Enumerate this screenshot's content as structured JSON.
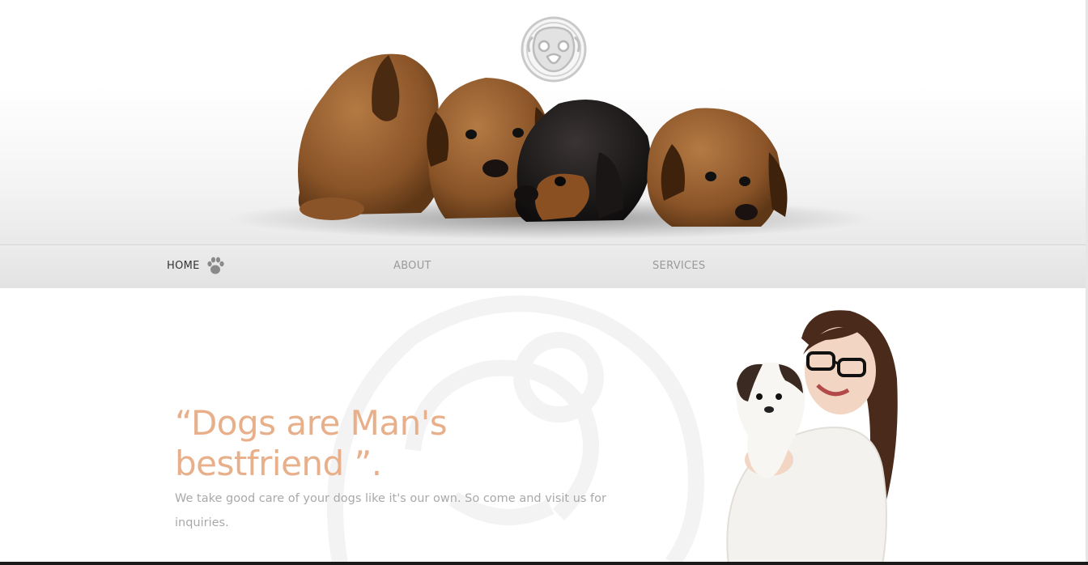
{
  "header": {
    "logo_icon": "pug-face-logo-icon",
    "hero_image": "four-puppies-image"
  },
  "nav": {
    "items": [
      {
        "label": "HOME",
        "active": true
      },
      {
        "label": "ABOUT",
        "active": false
      },
      {
        "label": "SERVICES",
        "active": false
      }
    ],
    "active_icon": "paw-icon"
  },
  "main": {
    "quote": "“Dogs are Man's bestfriend ”.",
    "description": "We take good care of your dogs like it's our own. So come and visit us for inquiries.",
    "image": "woman-holding-puppy-image"
  },
  "colors": {
    "accent": "#e8b08a",
    "nav_active": "#333333",
    "nav_inactive": "#9a9a9a",
    "body_text": "#a9a9a9"
  }
}
